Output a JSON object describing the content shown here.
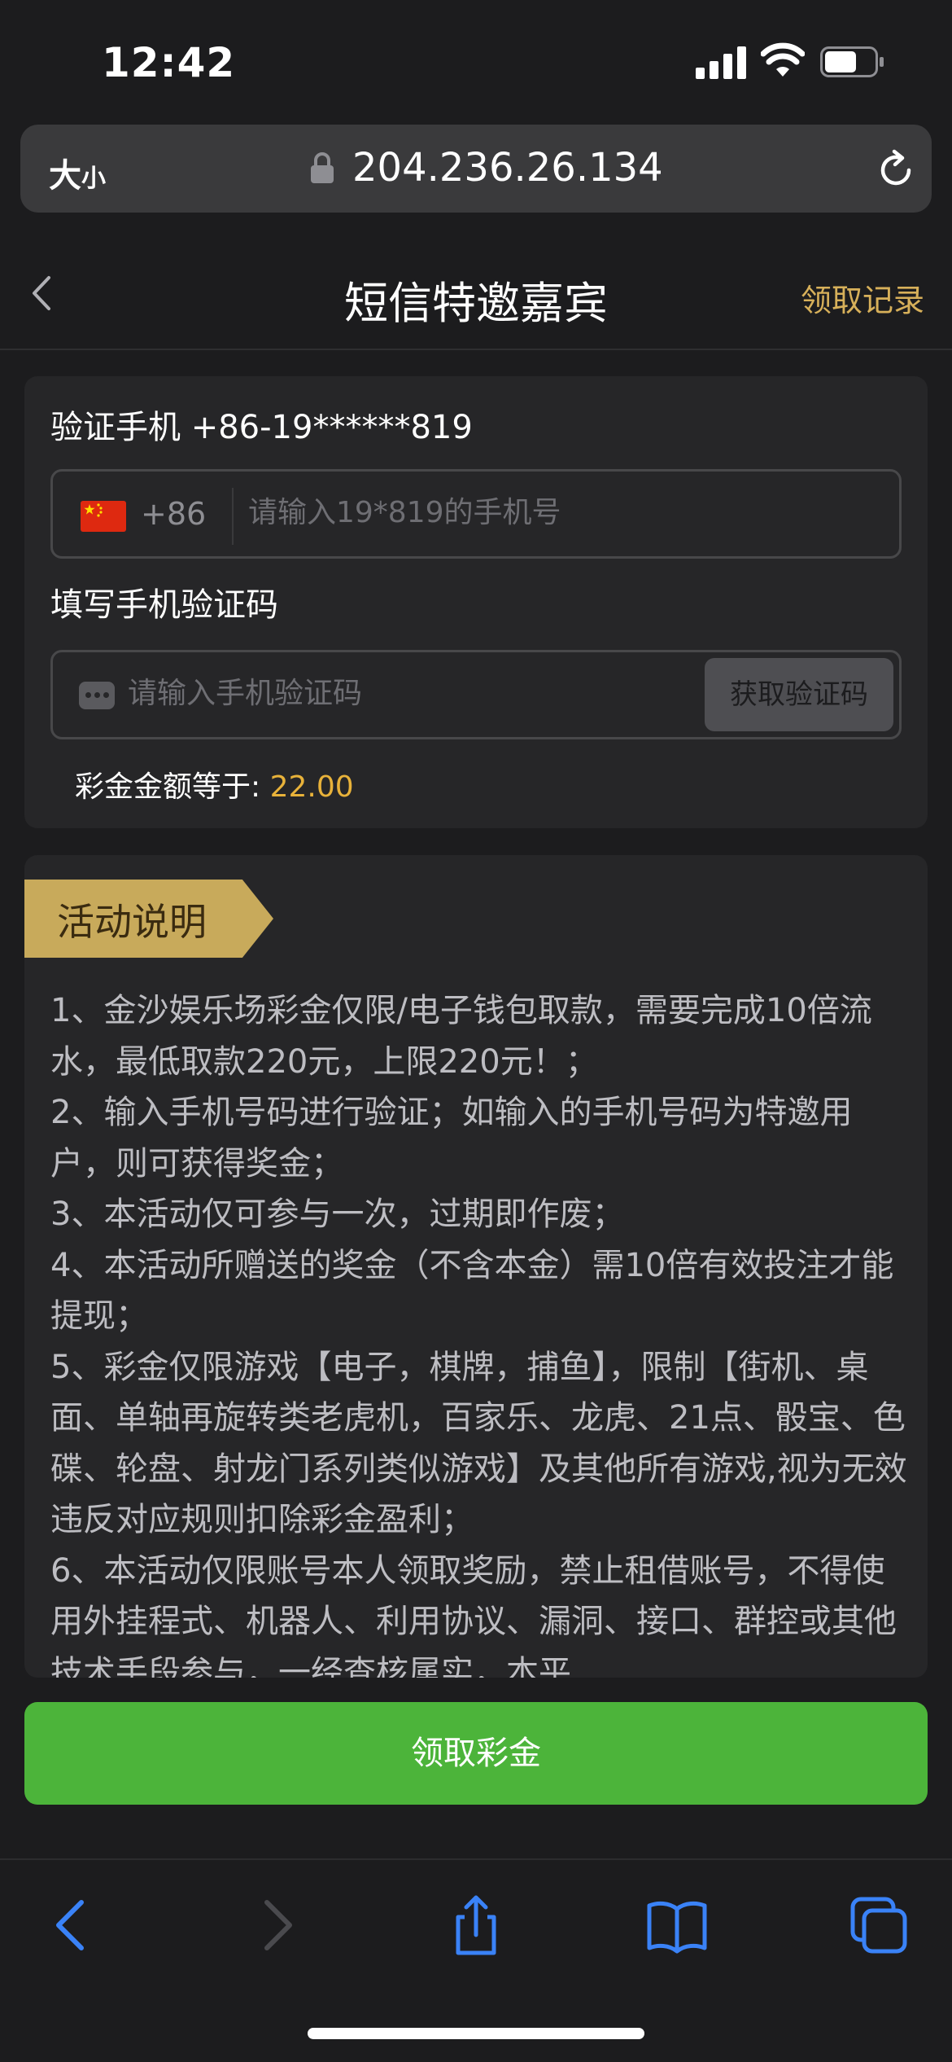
{
  "status_bar": {
    "time": "12:42"
  },
  "browser": {
    "text_size_big": "大",
    "text_size_small": "小",
    "url": "204.236.26.134"
  },
  "header": {
    "title": "短信特邀嘉宾",
    "records_label": "领取记录"
  },
  "verify": {
    "phone_label": "验证手机 +86-19******819",
    "country_code": "+86",
    "phone_placeholder": "请输入19*819的手机号",
    "code_label": "填写手机验证码",
    "code_placeholder": "请输入手机验证码",
    "get_code_label": "获取验证码",
    "bonus_label": "彩金金额等于:",
    "bonus_value": "22.00"
  },
  "rules": {
    "tag": "活动说明",
    "items": [
      "1、金沙娱乐场彩金仅限/电子钱包取款，需要完成10倍流水，最低取款220元，上限220元！；",
      "2、输入手机号码进行验证；如输入的手机号码为特邀用户，则可获得奖金；",
      "3、本活动仅可参与一次，过期即作废；",
      "4、本活动所赠送的奖金（不含本金）需10倍有效投注才能提现；",
      "5、彩金仅限游戏【电子，棋牌，捕鱼】，限制【街机、桌面、单轴再旋转类老虎机，百家乐、龙虎、21点、骰宝、色碟、轮盘、射龙门系列类似游戏】及其他所有游戏,视为无效违反对应规则扣除彩金盈利；",
      "6、本活动仅限账号本人领取奖励，禁止租借账号，不得使用外挂程式、机器人、利用协议、漏洞、接口、群控或其他技术手段参与，一经查核属实，本平"
    ]
  },
  "claim_button_label": "领取彩金",
  "colors": {
    "background": "#1c1c1e",
    "card": "#262628",
    "accent_gold": "#d7b05a",
    "bonus_value": "#e8b23a",
    "claim_green": "#4cb43a",
    "toolbar_blue": "#3a82f7"
  }
}
